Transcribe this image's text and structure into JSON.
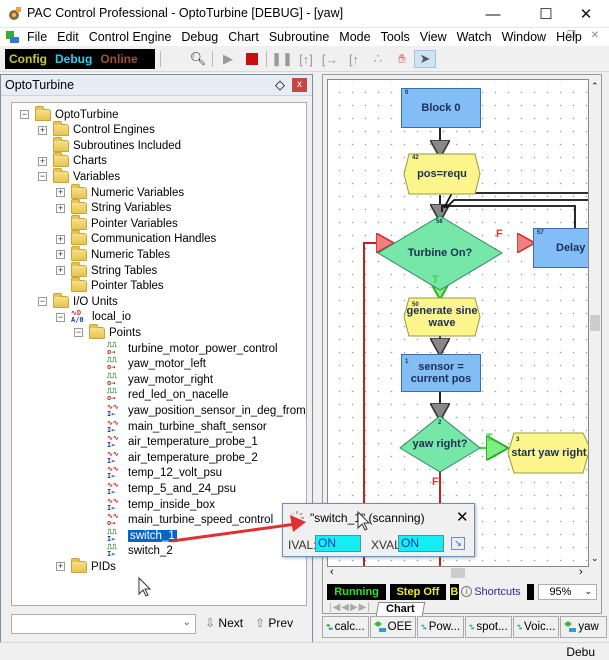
{
  "window": {
    "title": "PAC Control Professional - OptoTurbine [DEBUG] - [yaw]",
    "minimize": "—",
    "maximize": "☐",
    "close": "✕"
  },
  "menu": {
    "items": [
      "File",
      "Edit",
      "Control Engine",
      "Debug",
      "Chart",
      "Subroutine",
      "Mode",
      "Tools",
      "View",
      "Watch",
      "Window",
      "Help"
    ],
    "mdi_controls": "_  ❐ ✕"
  },
  "toolbar": {
    "modes": [
      {
        "label": "Config",
        "color": "#c9c930"
      },
      {
        "label": "Debug",
        "color": "#22d3ee"
      },
      {
        "label": "Online",
        "color": "#a0522d"
      }
    ],
    "buttons": [
      "find-icon",
      "run-icon",
      "stop-icon",
      "pause-icon",
      "step-over-icon",
      "step-into-icon",
      "step-out-icon",
      "breakpoint-icon",
      "hand-icon",
      "pointer-icon"
    ]
  },
  "left_pane": {
    "title": "OptoTurbine",
    "pin_icon": "◇",
    "close_icon": "x",
    "tree": [
      {
        "label": "OptoTurbine",
        "level": 0,
        "exp": "-",
        "icon": "folder"
      },
      {
        "label": "Control Engines",
        "level": 1,
        "exp": "+",
        "icon": "folder"
      },
      {
        "label": "Subroutines Included",
        "level": 1,
        "exp": "",
        "icon": "folder"
      },
      {
        "label": "Charts",
        "level": 1,
        "exp": "+",
        "icon": "folder"
      },
      {
        "label": "Variables",
        "level": 1,
        "exp": "-",
        "icon": "folder"
      },
      {
        "label": "Numeric Variables",
        "level": 2,
        "exp": "+",
        "icon": "folder"
      },
      {
        "label": "String Variables",
        "level": 2,
        "exp": "+",
        "icon": "folder"
      },
      {
        "label": "Pointer Variables",
        "level": 2,
        "exp": "",
        "icon": "folder"
      },
      {
        "label": "Communication Handles",
        "level": 2,
        "exp": "+",
        "icon": "folder"
      },
      {
        "label": "Numeric Tables",
        "level": 2,
        "exp": "+",
        "icon": "folder"
      },
      {
        "label": "String Tables",
        "level": 2,
        "exp": "+",
        "icon": "folder"
      },
      {
        "label": "Pointer Tables",
        "level": 2,
        "exp": "",
        "icon": "folder"
      },
      {
        "label": "I/O Units",
        "level": 1,
        "exp": "-",
        "icon": "folder"
      },
      {
        "label": "local_io",
        "level": 2,
        "exp": "-",
        "icon": "io-unit"
      },
      {
        "label": "Points",
        "level": 3,
        "exp": "-",
        "icon": "folder"
      },
      {
        "label": "turbine_motor_power_control",
        "level": 4,
        "exp": "",
        "icon": "digital-out"
      },
      {
        "label": "yaw_motor_left",
        "level": 4,
        "exp": "",
        "icon": "digital-out"
      },
      {
        "label": "yaw_motor_right",
        "level": 4,
        "exp": "",
        "icon": "digital-out"
      },
      {
        "label": "red_led_on_nacelle",
        "level": 4,
        "exp": "",
        "icon": "digital-out"
      },
      {
        "label": "yaw_position_sensor_in_deg_from_north",
        "level": 4,
        "exp": "",
        "icon": "analog-in"
      },
      {
        "label": "main_turbine_shaft_sensor",
        "level": 4,
        "exp": "",
        "icon": "analog-in"
      },
      {
        "label": "air_temperature_probe_1",
        "level": 4,
        "exp": "",
        "icon": "analog-in"
      },
      {
        "label": "air_temperature_probe_2",
        "level": 4,
        "exp": "",
        "icon": "analog-in"
      },
      {
        "label": "temp_12_volt_psu",
        "level": 4,
        "exp": "",
        "icon": "analog-in"
      },
      {
        "label": "temp_5_and_24_psu",
        "level": 4,
        "exp": "",
        "icon": "analog-in"
      },
      {
        "label": "temp_inside_box",
        "level": 4,
        "exp": "",
        "icon": "analog-in"
      },
      {
        "label": "main_turbine_speed_control",
        "level": 4,
        "exp": "",
        "icon": "analog-out"
      },
      {
        "label": "switch_1",
        "level": 4,
        "exp": "",
        "icon": "digital-in",
        "selected": true
      },
      {
        "label": "switch_2",
        "level": 4,
        "exp": "",
        "icon": "digital-in"
      },
      {
        "label": "PIDs",
        "level": 2,
        "exp": "+",
        "icon": "folder"
      }
    ],
    "search_value": "",
    "next_label": "Next",
    "prev_label": "Prev"
  },
  "flowchart": {
    "blocks": [
      {
        "id": "0",
        "label": "Block 0",
        "type": "action"
      },
      {
        "id": "42",
        "label": "pos=requ",
        "type": "ocmd"
      },
      {
        "id": "56",
        "label": "Turbine On?",
        "type": "condition"
      },
      {
        "id": "57",
        "label": "Delay",
        "type": "action"
      },
      {
        "id": "50",
        "label": "generate sine wave",
        "type": "ocmd"
      },
      {
        "id": "1",
        "label": "sensor = current pos",
        "type": "action"
      },
      {
        "id": "2",
        "label": "yaw right?",
        "type": "condition"
      },
      {
        "id": "3",
        "label": "start yaw right",
        "type": "ocmd"
      }
    ],
    "branch_labels": {
      "true": "T",
      "false": "F"
    }
  },
  "chart_status": {
    "running": "Running",
    "step": "Step Off",
    "break_partial": "B",
    "shortcuts": "Shortcuts",
    "zoom": "95%",
    "tab": "Chart"
  },
  "task_tabs": [
    "calc...",
    "OEE",
    "Pow...",
    "spot...",
    "Voic...",
    "yaw"
  ],
  "status_bar": {
    "mode": "Debu"
  },
  "popup": {
    "title": "\"switch_1\" (scanning)",
    "ival_label": "IVAL:",
    "ival": "ON",
    "xval_label": "XVAL:",
    "xval": "ON",
    "close": "✕"
  },
  "colors": {
    "action_block": "#82bdf6",
    "condition_block": "#77e6a9",
    "ocmd_block": "#fbf58c",
    "true_path": "#43d843",
    "false_path": "#d23b3b",
    "value_bg": "#13eef3",
    "selection": "#0a64c8"
  }
}
